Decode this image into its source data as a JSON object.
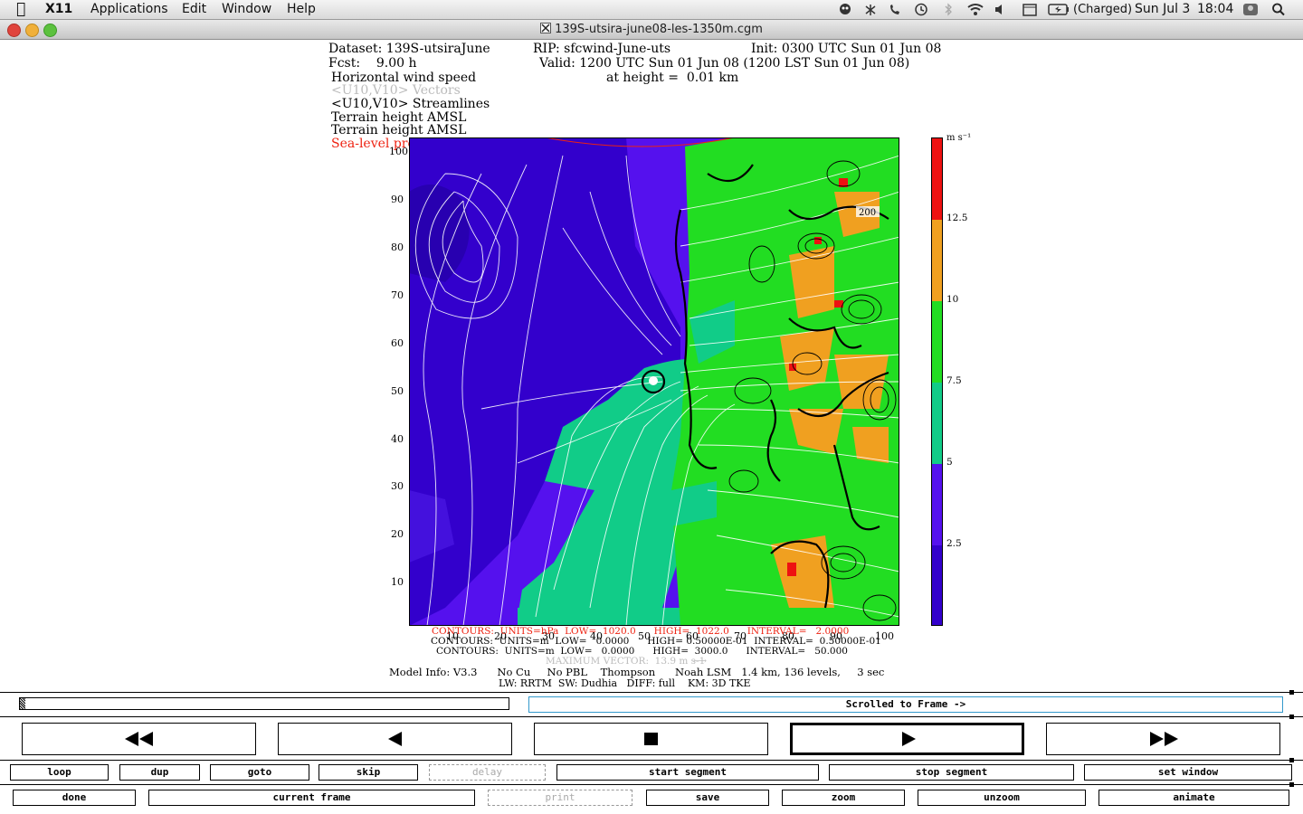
{
  "menubar": {
    "app": "X11",
    "items": [
      "Applications",
      "Edit",
      "Window",
      "Help"
    ],
    "battery": "(Charged)",
    "date": "Sun Jul 3",
    "time": "18:04"
  },
  "window": {
    "title": "139S-utsira-june08-les-1350m.cgm"
  },
  "plot": {
    "dataset": "Dataset: 139S-utsiraJune",
    "rip": "RIP: sfcwind-June-uts",
    "init": "Init: 0300 UTC Sun 01 Jun 08",
    "fcst": "Fcst:    9.00 h",
    "valid": "Valid: 1200 UTC Sun 01 Jun 08 (1200 LST Sun 01 Jun 08)",
    "field1": "Horizontal wind speed",
    "height": "at height =  0.01 km",
    "field2": "<U10,V10> Vectors",
    "field3": "<U10,V10> Streamlines",
    "field4": "Terrain height AMSL",
    "field5": "Terrain height AMSL",
    "field6": "Sea-level pressure",
    "y_ticks": [
      "100",
      "90",
      "80",
      "70",
      "60",
      "50",
      "40",
      "30",
      "20",
      "10"
    ],
    "x_ticks": [
      "10",
      "20",
      "30",
      "40",
      "50",
      "60",
      "70",
      "80",
      "90",
      "100"
    ],
    "colorbar_unit": "m s⁻¹",
    "colorbar_labels": [
      "12.5",
      "10",
      "7.5",
      "5",
      "2.5"
    ],
    "colorbar_colors": [
      "#ee1111",
      "#f0a020",
      "#22dd22",
      "#11cc88",
      "#5511ee",
      "#3300cc"
    ],
    "contour_label": "200",
    "footer1": "CONTOURS:  UNITS=hPa  LOW=  1020.0      HIGH=  1022.0      INTERVAL=   2.0000",
    "footer2": "CONTOURS:  UNITS=m  LOW=   0.0000      HIGH= 0.50000E-01  INTERVAL=  0.50000E-01",
    "footer3": "CONTOURS:  UNITS=m  LOW=   0.0000      HIGH=  3000.0      INTERVAL=   50.000",
    "footer4": "MAXIMUM VECTOR:  13.9 m s-1",
    "model1": "Model Info: V3.3      No Cu     No PBL    Thompson      Noah LSM   1.4 km, 136 levels,     3 sec",
    "model2": "LW: RRTM  SW: Dudhia   DIFF: full    KM: 3D TKE"
  },
  "controls": {
    "status": "Scrolled to Frame ->",
    "row1": [
      "loop",
      "dup",
      "goto",
      "skip",
      "delay",
      "start segment",
      "stop segment",
      "set window"
    ],
    "row2": [
      "done",
      "current frame",
      "print",
      "save",
      "zoom",
      "unzoom",
      "animate"
    ]
  }
}
